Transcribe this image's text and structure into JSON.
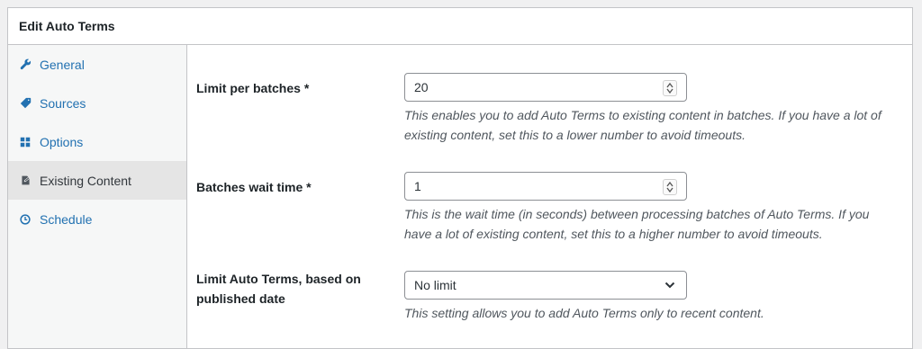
{
  "panel": {
    "title": "Edit Auto Terms"
  },
  "sidebar": {
    "items": [
      {
        "label": "General",
        "icon": "wrench-icon",
        "active": false
      },
      {
        "label": "Sources",
        "icon": "tag-icon",
        "active": false
      },
      {
        "label": "Options",
        "icon": "grid-icon",
        "active": false
      },
      {
        "label": "Existing Content",
        "icon": "content-icon",
        "active": true
      },
      {
        "label": "Schedule",
        "icon": "clock-icon",
        "active": false
      }
    ]
  },
  "fields": {
    "limit_per_batches": {
      "label": "Limit per batches",
      "required": "*",
      "value": "20",
      "description": "This enables you to add Auto Terms to existing content in batches. If you have a lot of existing content, set this to a lower number to avoid timeouts."
    },
    "batches_wait_time": {
      "label": "Batches wait time",
      "required": "*",
      "value": "1",
      "description": "This is the wait time (in seconds) between processing batches of Auto Terms. If you have a lot of existing content, set this to a higher number to avoid timeouts."
    },
    "limit_by_date": {
      "label": "Limit Auto Terms, based on published date",
      "selected": "No limit",
      "description": "This setting allows you to add Auto Terms only to recent content."
    }
  },
  "colors": {
    "link": "#2271b1",
    "border": "#c3c4c7",
    "active_bg": "#e5e5e5"
  }
}
